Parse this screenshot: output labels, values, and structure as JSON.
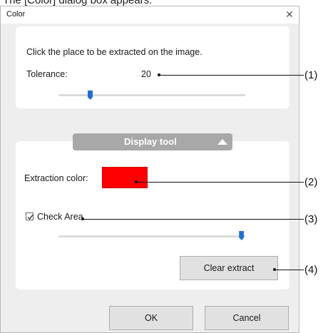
{
  "caption": "The [Color] dialog box appears.",
  "dialog": {
    "title": "Color",
    "close_glyph": "✕"
  },
  "extraction": {
    "instruction": "Click the place to be extracted on the image.",
    "tolerance_label": "Tolerance:",
    "tolerance_value": "20",
    "tolerance_fraction": 0.17
  },
  "display_tool": {
    "label": "Display tool",
    "expanded": true,
    "extraction_color_label": "Extraction color:",
    "extraction_color": "#ff0000",
    "check_area_label": "Check Area",
    "check_area_checked": true,
    "check_area_fraction": 0.98,
    "clear_button": "Clear extract"
  },
  "buttons": {
    "ok": "OK",
    "cancel": "Cancel"
  },
  "callouts": [
    "(1)",
    "(2)",
    "(3)",
    "(4)"
  ],
  "colors": {
    "accent": "#1f6fd0",
    "swatch": "#ff0000"
  }
}
